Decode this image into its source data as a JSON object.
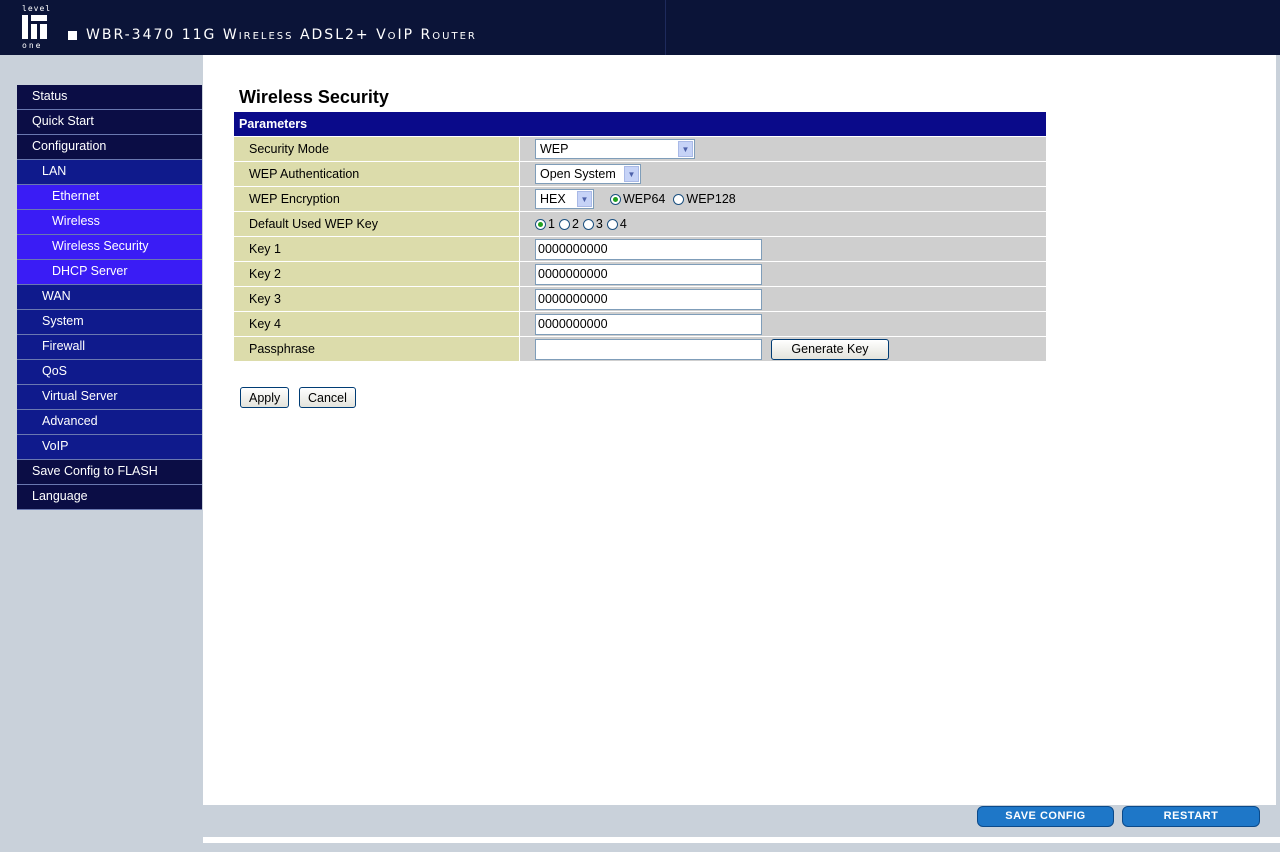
{
  "header": {
    "logo_top": "level",
    "logo_bottom": "one",
    "product_title": "WBR-3470 11G Wireless ADSL2+ VoIP Router"
  },
  "nav": {
    "items": [
      {
        "label": "Status",
        "level": 0
      },
      {
        "label": "Quick Start",
        "level": 0
      },
      {
        "label": "Configuration",
        "level": 0
      },
      {
        "label": "LAN",
        "level": 1
      },
      {
        "label": "Ethernet",
        "level": 2
      },
      {
        "label": "Wireless",
        "level": 2
      },
      {
        "label": "Wireless Security",
        "level": 2
      },
      {
        "label": "DHCP Server",
        "level": 2
      },
      {
        "label": "WAN",
        "level": 1
      },
      {
        "label": "System",
        "level": 1
      },
      {
        "label": "Firewall",
        "level": 1
      },
      {
        "label": "QoS",
        "level": 1
      },
      {
        "label": "Virtual Server",
        "level": 1
      },
      {
        "label": "Advanced",
        "level": 1
      },
      {
        "label": "VoIP",
        "level": 1
      },
      {
        "label": "Save Config to FLASH",
        "level": 0
      },
      {
        "label": "Language",
        "level": 0
      }
    ]
  },
  "page": {
    "title": "Wireless Security",
    "section_header": "Parameters"
  },
  "form": {
    "security_mode": {
      "label": "Security Mode",
      "value": "WEP"
    },
    "wep_auth": {
      "label": "WEP Authentication",
      "value": "Open System"
    },
    "wep_encryption": {
      "label": "WEP Encryption",
      "value": "HEX",
      "option_64": "WEP64",
      "option_128": "WEP128",
      "selected": "WEP64"
    },
    "default_key": {
      "label": "Default Used WEP Key",
      "options": [
        "1",
        "2",
        "3",
        "4"
      ],
      "selected": "1"
    },
    "key1": {
      "label": "Key 1",
      "value": "0000000000"
    },
    "key2": {
      "label": "Key 2",
      "value": "0000000000"
    },
    "key3": {
      "label": "Key 3",
      "value": "0000000000"
    },
    "key4": {
      "label": "Key 4",
      "value": "0000000000"
    },
    "passphrase": {
      "label": "Passphrase",
      "value": "",
      "generate_label": "Generate Key"
    }
  },
  "actions": {
    "apply_label": "Apply",
    "cancel_label": "Cancel"
  },
  "footer": {
    "save_config_label": "SAVE CONFIG",
    "restart_label": "RESTART"
  },
  "colors": {
    "header_bg": "#0b1438",
    "nav_level0": "#0b0d45",
    "nav_level1": "#0f1a8c",
    "nav_level2": "#3a1cf5",
    "section_header": "#0a0a8a",
    "label_cell": "#dcdcab",
    "value_cell": "#cfcfcf",
    "footer_button": "#1e77c8"
  }
}
